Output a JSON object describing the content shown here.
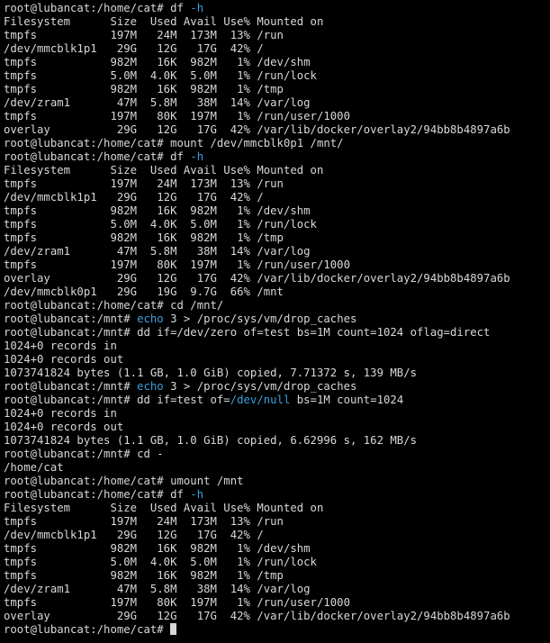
{
  "colors": {
    "background": "#000000",
    "foreground": "#d8d8d8",
    "highlight": "#3aa0d8"
  },
  "terminal": {
    "lines": [
      {
        "segments": [
          {
            "text": "root@lubancat:/home/cat# df "
          },
          {
            "text": "-h",
            "hl": true
          }
        ]
      },
      {
        "segments": [
          {
            "text": "Filesystem      Size  Used Avail Use% Mounted on"
          }
        ]
      },
      {
        "segments": [
          {
            "text": "tmpfs           197M   24M  173M  13% /run"
          }
        ]
      },
      {
        "segments": [
          {
            "text": "/dev/mmcblk1p1   29G   12G   17G  42% /"
          }
        ]
      },
      {
        "segments": [
          {
            "text": "tmpfs           982M   16K  982M   1% /dev/shm"
          }
        ]
      },
      {
        "segments": [
          {
            "text": "tmpfs           5.0M  4.0K  5.0M   1% /run/lock"
          }
        ]
      },
      {
        "segments": [
          {
            "text": "tmpfs           982M   16K  982M   1% /tmp"
          }
        ]
      },
      {
        "segments": [
          {
            "text": "/dev/zram1       47M  5.8M   38M  14% /var/log"
          }
        ]
      },
      {
        "segments": [
          {
            "text": "tmpfs           197M   80K  197M   1% /run/user/1000"
          }
        ]
      },
      {
        "segments": [
          {
            "text": "overlay          29G   12G   17G  42% /var/lib/docker/overlay2/94bb8b4897a6b"
          }
        ]
      },
      {
        "segments": [
          {
            "text": "root@lubancat:/home/cat# mount /dev/mmcblk0p1 /mnt/"
          }
        ]
      },
      {
        "segments": [
          {
            "text": "root@lubancat:/home/cat# df "
          },
          {
            "text": "-h",
            "hl": true
          }
        ]
      },
      {
        "segments": [
          {
            "text": "Filesystem      Size  Used Avail Use% Mounted on"
          }
        ]
      },
      {
        "segments": [
          {
            "text": "tmpfs           197M   24M  173M  13% /run"
          }
        ]
      },
      {
        "segments": [
          {
            "text": "/dev/mmcblk1p1   29G   12G   17G  42% /"
          }
        ]
      },
      {
        "segments": [
          {
            "text": "tmpfs           982M   16K  982M   1% /dev/shm"
          }
        ]
      },
      {
        "segments": [
          {
            "text": "tmpfs           5.0M  4.0K  5.0M   1% /run/lock"
          }
        ]
      },
      {
        "segments": [
          {
            "text": "tmpfs           982M   16K  982M   1% /tmp"
          }
        ]
      },
      {
        "segments": [
          {
            "text": "/dev/zram1       47M  5.8M   38M  14% /var/log"
          }
        ]
      },
      {
        "segments": [
          {
            "text": "tmpfs           197M   80K  197M   1% /run/user/1000"
          }
        ]
      },
      {
        "segments": [
          {
            "text": "overlay          29G   12G   17G  42% /var/lib/docker/overlay2/94bb8b4897a6b"
          }
        ]
      },
      {
        "segments": [
          {
            "text": "/dev/mmcblk0p1   29G   19G  9.7G  66% /mnt"
          }
        ]
      },
      {
        "segments": [
          {
            "text": "root@lubancat:/home/cat# cd /mnt/"
          }
        ]
      },
      {
        "segments": [
          {
            "text": "root@lubancat:/mnt# "
          },
          {
            "text": "echo",
            "hl": true
          },
          {
            "text": " 3 > /proc/sys/vm/drop_caches"
          }
        ]
      },
      {
        "segments": [
          {
            "text": "root@lubancat:/mnt# dd if=/dev/zero of=test bs=1M count=1024 oflag=direct"
          }
        ]
      },
      {
        "segments": [
          {
            "text": "1024+0 records in"
          }
        ]
      },
      {
        "segments": [
          {
            "text": "1024+0 records out"
          }
        ]
      },
      {
        "segments": [
          {
            "text": "1073741824 bytes (1.1 GB, 1.0 GiB) copied, 7.71372 s, 139 MB/s"
          }
        ]
      },
      {
        "segments": [
          {
            "text": "root@lubancat:/mnt# "
          },
          {
            "text": "echo",
            "hl": true
          },
          {
            "text": " 3 > /proc/sys/vm/drop_caches"
          }
        ]
      },
      {
        "segments": [
          {
            "text": "root@lubancat:/mnt# dd if=test of="
          },
          {
            "text": "/dev/null",
            "hl": true
          },
          {
            "text": " bs=1M count=1024"
          }
        ]
      },
      {
        "segments": [
          {
            "text": "1024+0 records in"
          }
        ]
      },
      {
        "segments": [
          {
            "text": "1024+0 records out"
          }
        ]
      },
      {
        "segments": [
          {
            "text": "1073741824 bytes (1.1 GB, 1.0 GiB) copied, 6.62996 s, 162 MB/s"
          }
        ]
      },
      {
        "segments": [
          {
            "text": "root@lubancat:/mnt# cd -"
          }
        ]
      },
      {
        "segments": [
          {
            "text": "/home/cat"
          }
        ]
      },
      {
        "segments": [
          {
            "text": "root@lubancat:/home/cat# umount /mnt"
          }
        ]
      },
      {
        "segments": [
          {
            "text": "root@lubancat:/home/cat# df "
          },
          {
            "text": "-h",
            "hl": true
          }
        ]
      },
      {
        "segments": [
          {
            "text": "Filesystem      Size  Used Avail Use% Mounted on"
          }
        ]
      },
      {
        "segments": [
          {
            "text": "tmpfs           197M   24M  173M  13% /run"
          }
        ]
      },
      {
        "segments": [
          {
            "text": "/dev/mmcblk1p1   29G   12G   17G  42% /"
          }
        ]
      },
      {
        "segments": [
          {
            "text": "tmpfs           982M   16K  982M   1% /dev/shm"
          }
        ]
      },
      {
        "segments": [
          {
            "text": "tmpfs           5.0M  4.0K  5.0M   1% /run/lock"
          }
        ]
      },
      {
        "segments": [
          {
            "text": "tmpfs           982M   16K  982M   1% /tmp"
          }
        ]
      },
      {
        "segments": [
          {
            "text": "/dev/zram1       47M  5.8M   38M  14% /var/log"
          }
        ]
      },
      {
        "segments": [
          {
            "text": "tmpfs           197M   80K  197M   1% /run/user/1000"
          }
        ]
      },
      {
        "segments": [
          {
            "text": "overlay          29G   12G   17G  42% /var/lib/docker/overlay2/94bb8b4897a6b"
          }
        ]
      },
      {
        "segments": [
          {
            "text": "root@lubancat:/home/cat# "
          }
        ],
        "cursor": true
      }
    ]
  }
}
